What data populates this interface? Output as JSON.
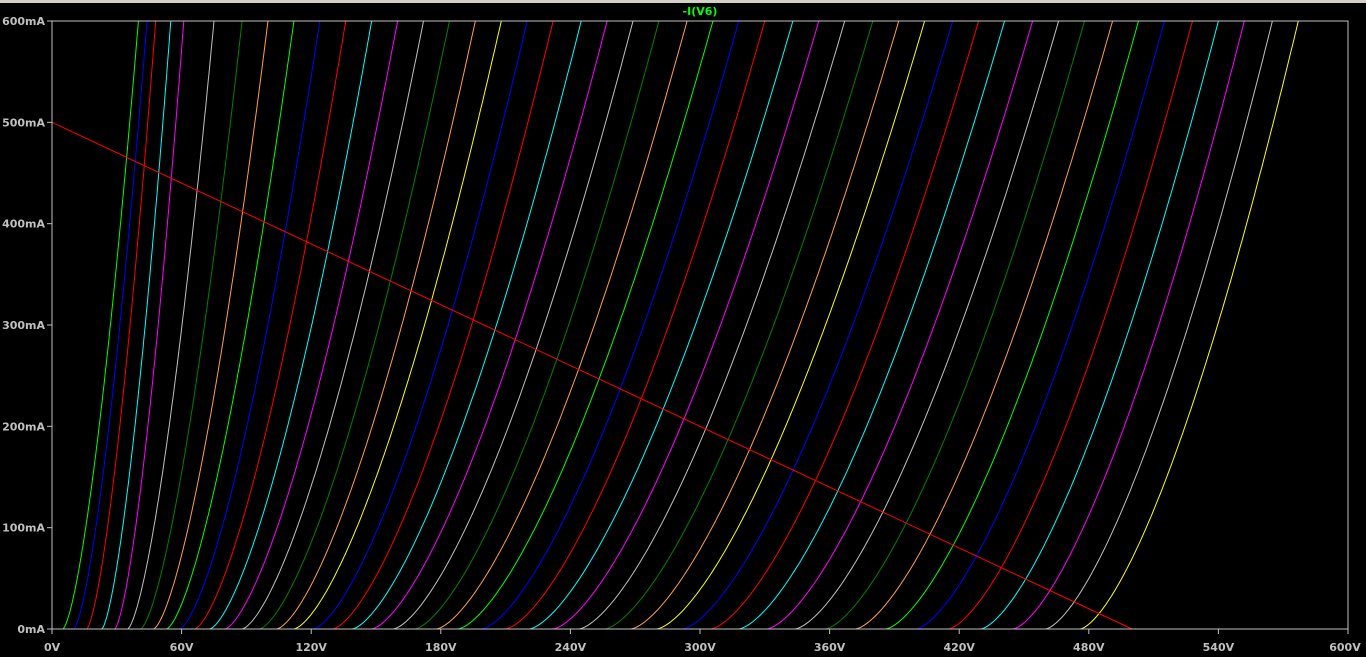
{
  "chart_data": {
    "type": "line",
    "title": "-I(V6)",
    "xlabel": "",
    "ylabel": "",
    "xlim": [
      0,
      600
    ],
    "ylim": [
      0,
      600
    ],
    "x_ticks": [
      "0V",
      "60V",
      "120V",
      "180V",
      "240V",
      "300V",
      "360V",
      "420V",
      "480V",
      "540V",
      "600V"
    ],
    "y_ticks": [
      "0mA",
      "100mA",
      "200mA",
      "300mA",
      "400mA",
      "500mA",
      "600mA"
    ],
    "grid": false,
    "curve_family": {
      "count": 47,
      "x_unit": "V",
      "y_unit": "mA",
      "description_of_sweep": "family of plate curves",
      "cutoff_voltages": [
        5,
        10,
        16,
        23,
        29,
        35,
        41,
        47,
        53,
        59,
        66,
        73,
        80,
        88,
        96,
        104,
        112,
        121,
        130,
        139,
        148,
        158,
        168,
        178,
        188,
        199,
        210,
        221,
        232,
        244,
        256,
        268,
        280,
        292,
        305,
        318,
        331,
        344,
        358,
        372,
        386,
        400,
        415,
        430,
        445,
        460,
        476
      ],
      "voltage_at_600mA": [
        40,
        44,
        48,
        55,
        61,
        75,
        88,
        100,
        112,
        124,
        136,
        148,
        160,
        172,
        184,
        196,
        208,
        220,
        232,
        245,
        257,
        269,
        281,
        294,
        306,
        318,
        330,
        343,
        355,
        367,
        380,
        392,
        404,
        417,
        429,
        441,
        454,
        466,
        478,
        491,
        503,
        515,
        528,
        540,
        552,
        565,
        577
      ],
      "colors": [
        "#00ff00",
        "#0000ff",
        "#ff0000",
        "#00ffff",
        "#ff00ff",
        "#c0c0c0",
        "#008000",
        "#ffa040",
        "#00ff00",
        "#0000ff",
        "#ff0000",
        "#00ffff",
        "#ff00ff",
        "#c0c0c0",
        "#008000",
        "#ffa040",
        "#ffff00",
        "#0000ff",
        "#ff0000",
        "#00ffff",
        "#ff00ff",
        "#c0c0c0",
        "#008000",
        "#ffa040",
        "#00ff00",
        "#0000ff",
        "#ff0000",
        "#00ffff",
        "#ff00ff",
        "#c0c0c0",
        "#008000",
        "#ffa040",
        "#ffff00",
        "#0000ff",
        "#ff0000",
        "#00ffff",
        "#ff00ff",
        "#c0c0c0",
        "#008000",
        "#ffa040",
        "#00ff00",
        "#0000ff",
        "#ff0000",
        "#00ffff",
        "#ff00ff",
        "#c0c0c0",
        "#ffff00"
      ]
    },
    "load_line": {
      "x": [
        0,
        500
      ],
      "y": [
        500,
        0
      ],
      "color": "#ff0000"
    },
    "colors": {
      "background": "#000000",
      "axis": "#c0c0c0",
      "title": "#00ff00"
    }
  }
}
